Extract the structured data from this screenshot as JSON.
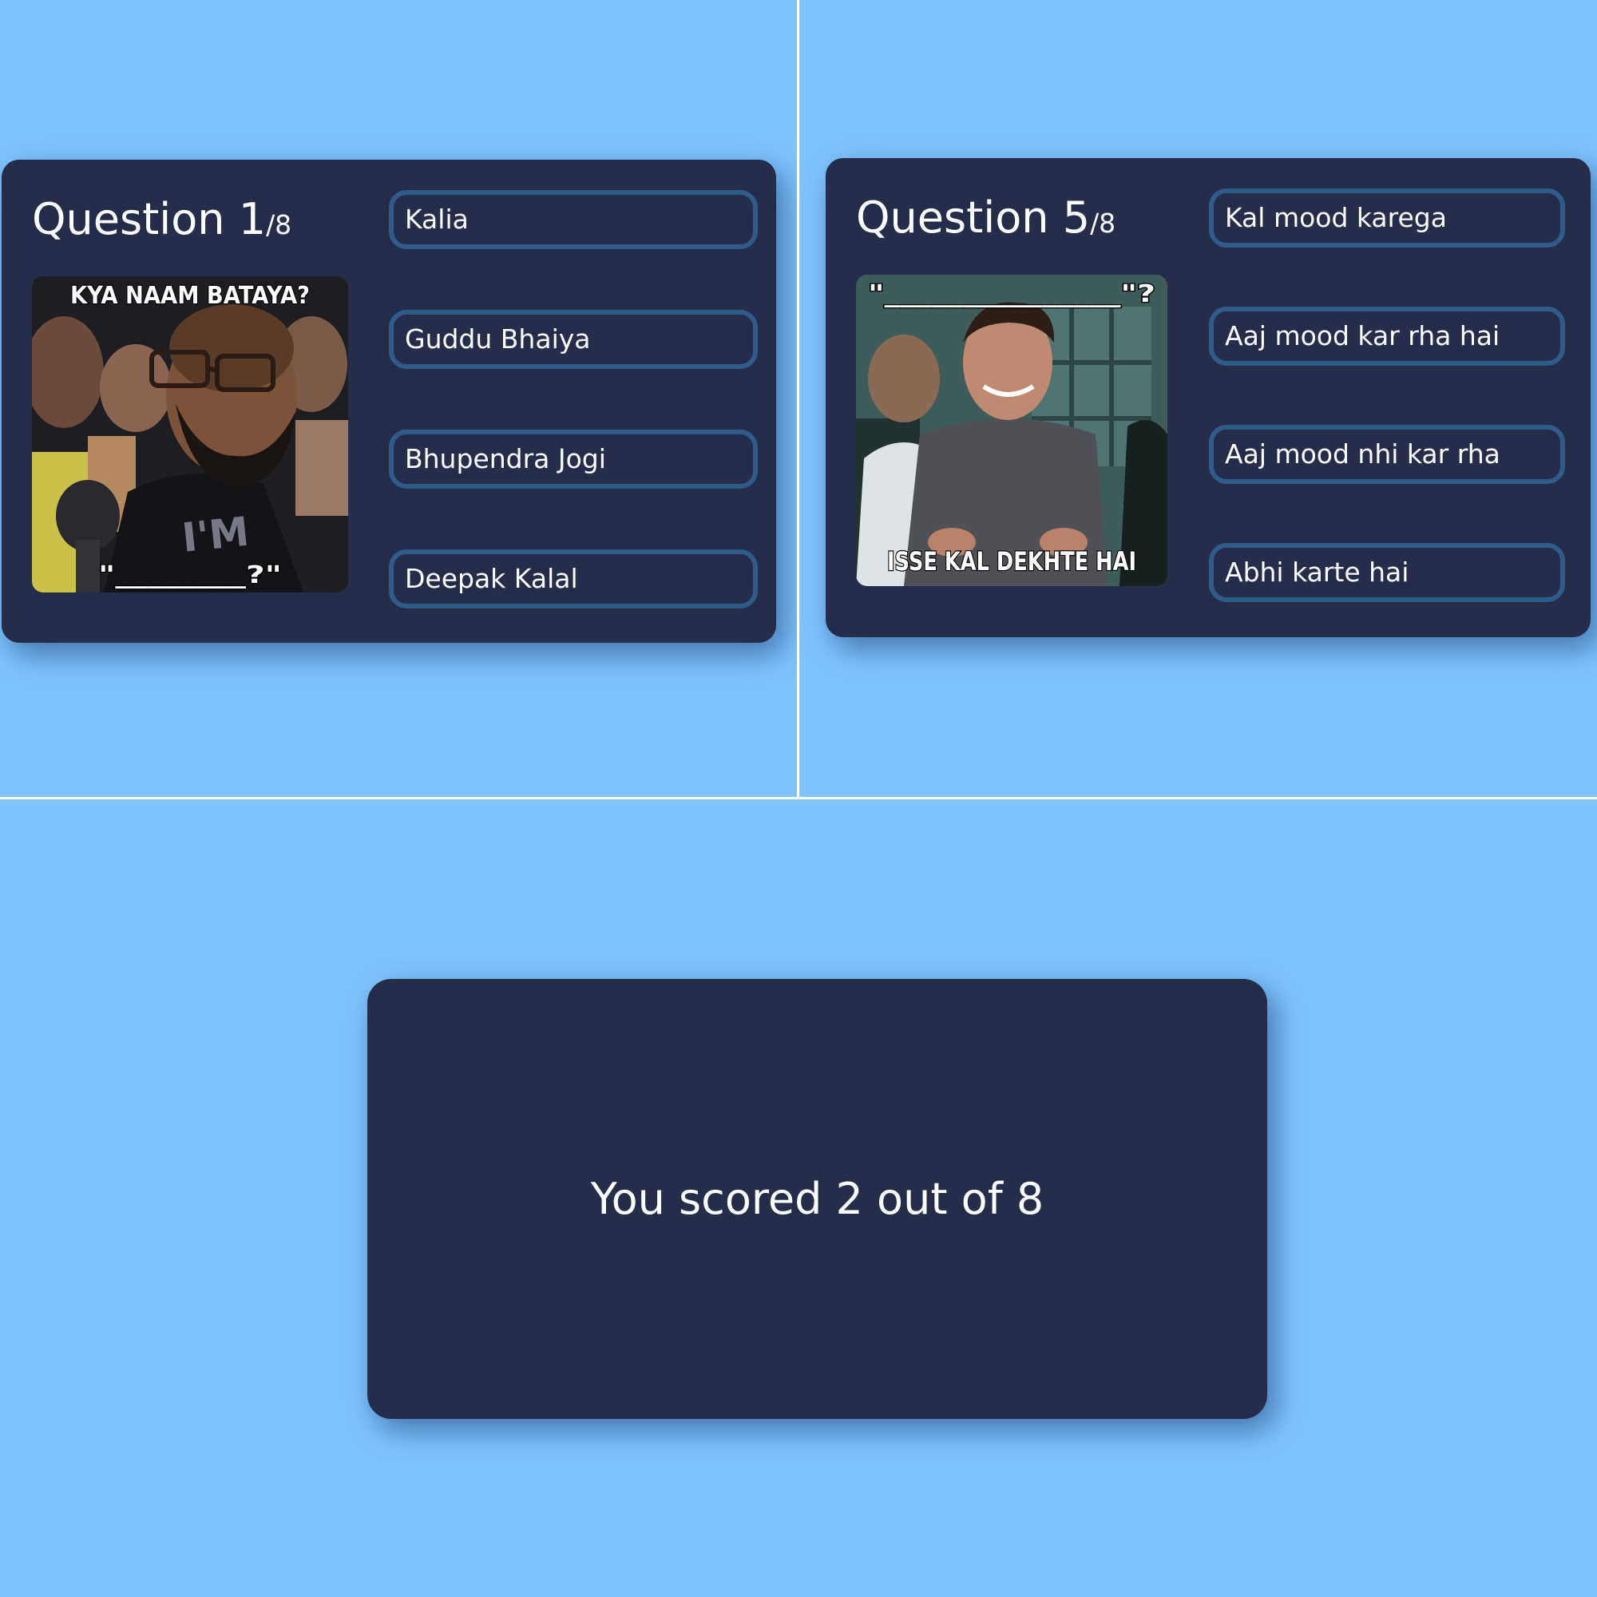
{
  "question_1": {
    "label": "Question ",
    "number": "1",
    "total": "/8",
    "meme_top_caption": "KYA NAAM BATAYA?",
    "meme_bottom_caption": "\"________?\"",
    "answers": [
      "Kalia",
      "Guddu Bhaiya",
      "Bhupendra Jogi",
      "Deepak Kalal"
    ]
  },
  "question_5": {
    "label": "Question ",
    "number": "5",
    "total": "/8",
    "meme_top_caption": "\"_______________\"?",
    "meme_bottom_caption": "ISSE KAL DEKHTE HAI",
    "answers": [
      "Kal mood karega",
      "Aaj mood kar rha hai",
      "Aaj mood nhi kar rha",
      "Abhi karte hai"
    ]
  },
  "result": {
    "text": "You scored 2 out of 8"
  },
  "colors": {
    "page_background": "#7ec4fd",
    "card_background": "#252d4a",
    "answer_border": "#2f5b8c",
    "text": "#ffffff"
  }
}
